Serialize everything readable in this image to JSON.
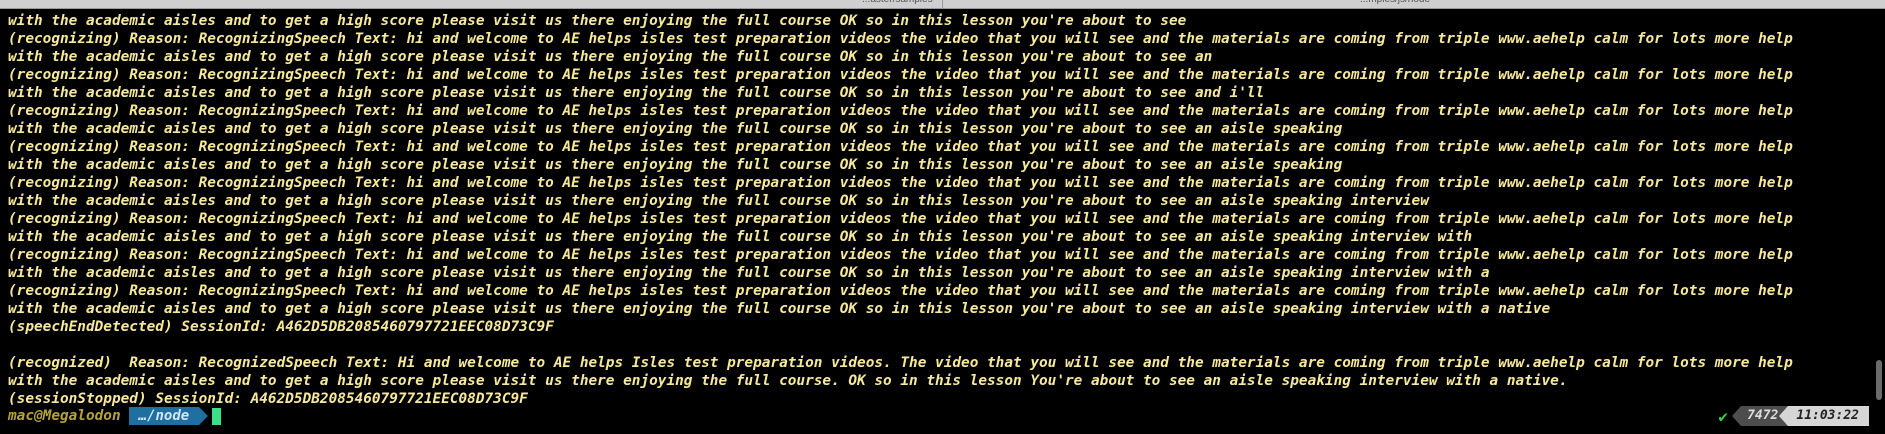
{
  "tabs": [
    {
      "label": "...aster/samples"
    },
    {
      "label": "...mples/js/node"
    }
  ],
  "terminal": {
    "lines": [
      "with the academic aisles and to get a high score please visit us there enjoying the full course OK so in this lesson you're about to see",
      "(recognizing) Reason: RecognizingSpeech Text: hi and welcome to AE helps isles test preparation videos the video that you will see and the materials are coming from triple www.aehelp calm for lots more help",
      "with the academic aisles and to get a high score please visit us there enjoying the full course OK so in this lesson you're about to see an",
      "(recognizing) Reason: RecognizingSpeech Text: hi and welcome to AE helps isles test preparation videos the video that you will see and the materials are coming from triple www.aehelp calm for lots more help",
      "with the academic aisles and to get a high score please visit us there enjoying the full course OK so in this lesson you're about to see and i'll",
      "(recognizing) Reason: RecognizingSpeech Text: hi and welcome to AE helps isles test preparation videos the video that you will see and the materials are coming from triple www.aehelp calm for lots more help",
      "with the academic aisles and to get a high score please visit us there enjoying the full course OK so in this lesson you're about to see an aisle speaking",
      "(recognizing) Reason: RecognizingSpeech Text: hi and welcome to AE helps isles test preparation videos the video that you will see and the materials are coming from triple www.aehelp calm for lots more help",
      "with the academic aisles and to get a high score please visit us there enjoying the full course OK so in this lesson you're about to see an aisle speaking",
      "(recognizing) Reason: RecognizingSpeech Text: hi and welcome to AE helps isles test preparation videos the video that you will see and the materials are coming from triple www.aehelp calm for lots more help",
      "with the academic aisles and to get a high score please visit us there enjoying the full course OK so in this lesson you're about to see an aisle speaking interview",
      "(recognizing) Reason: RecognizingSpeech Text: hi and welcome to AE helps isles test preparation videos the video that you will see and the materials are coming from triple www.aehelp calm for lots more help",
      "with the academic aisles and to get a high score please visit us there enjoying the full course OK so in this lesson you're about to see an aisle speaking interview with",
      "(recognizing) Reason: RecognizingSpeech Text: hi and welcome to AE helps isles test preparation videos the video that you will see and the materials are coming from triple www.aehelp calm for lots more help",
      "with the academic aisles and to get a high score please visit us there enjoying the full course OK so in this lesson you're about to see an aisle speaking interview with a",
      "(recognizing) Reason: RecognizingSpeech Text: hi and welcome to AE helps isles test preparation videos the video that you will see and the materials are coming from triple www.aehelp calm for lots more help",
      "with the academic aisles and to get a high score please visit us there enjoying the full course OK so in this lesson you're about to see an aisle speaking interview with a native",
      "(speechEndDetected) SessionId: A462D5DB2085460797721EEC08D73C9F",
      "",
      "(recognized)  Reason: RecognizedSpeech Text: Hi and welcome to AE helps Isles test preparation videos. The video that you will see and the materials are coming from triple www.aehelp calm for lots more help",
      "with the academic aisles and to get a high score please visit us there enjoying the full course. OK so in this lesson You're about to see an aisle speaking interview with a native.",
      "(sessionStopped) SessionId: A462D5DB2085460797721EEC08D73C9F"
    ]
  },
  "prompt": {
    "user_host": "mac@Megalodon",
    "directory": "…/node"
  },
  "status": {
    "check_icon": "check-icon",
    "history_number": "7472",
    "time": "11:03:22"
  },
  "colors": {
    "background": "#000000",
    "text": "#f7e99b",
    "prompt_user": "#b5a437",
    "directory_segment": "#1f6fa0",
    "cursor": "#3ddf86",
    "check": "#3ccf3c"
  }
}
